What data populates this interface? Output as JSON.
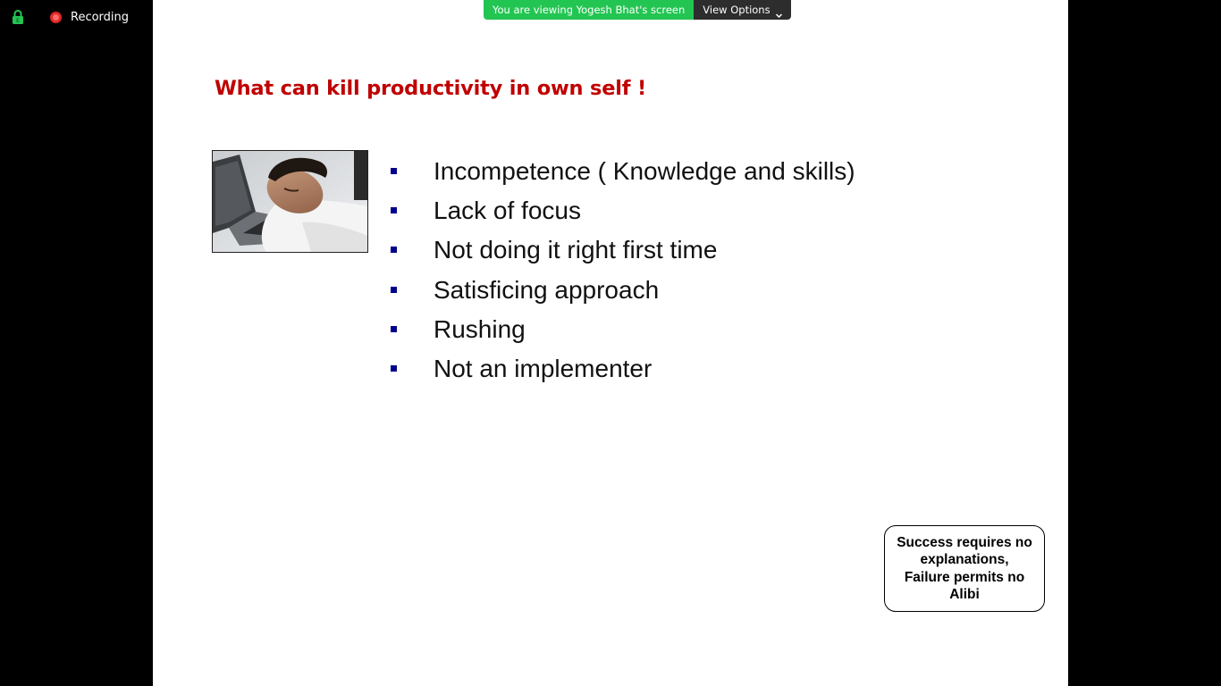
{
  "meeting": {
    "recording_label": "Recording",
    "banner_text": "You are viewing Yogesh Bhat's screen",
    "view_options_label": "View Options",
    "icons": {
      "encryption": "lock-shield-icon",
      "recording": "record-dot-icon",
      "view_options": "chevron-down-icon"
    },
    "colors": {
      "banner_green": "#23c552",
      "recording_red": "#e02828",
      "encryption_green": "#23c552"
    }
  },
  "slide": {
    "title": "What can kill productivity in own self !",
    "title_color": "#c00000",
    "bullet_color": "#00008b",
    "bullets": [
      "Incompetence ( Knowledge and skills)",
      "Lack of focus",
      "Not doing it right first time",
      "Satisficing approach",
      "Rushing",
      "Not an implementer"
    ],
    "quote": "Success requires  no explanations,\nFailure permits no Alibi"
  }
}
